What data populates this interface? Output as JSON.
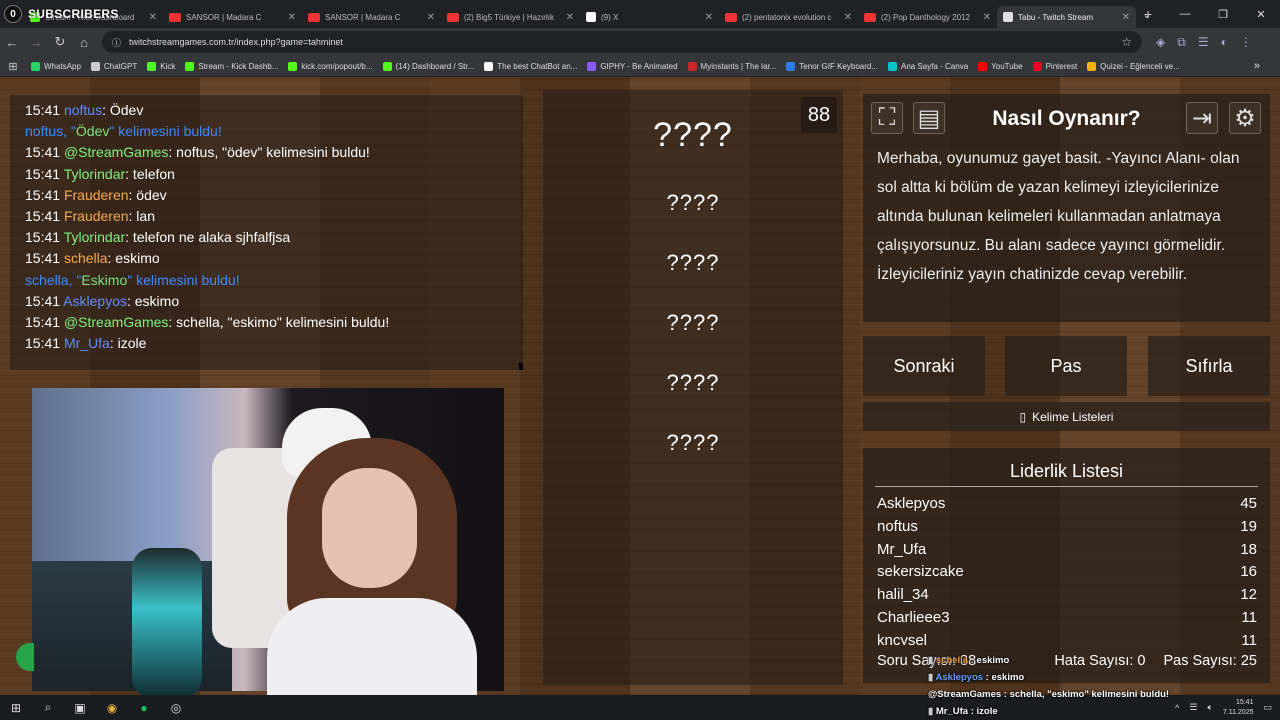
{
  "browser": {
    "overlay_badge": {
      "left_count": "0",
      "label": "SUBSCRIBERS",
      "right_count": "5"
    },
    "tabs": [
      {
        "title": "Stream - Kick Dashboard",
        "icon": "kick"
      },
      {
        "title": "SANSOR | Madara C",
        "icon": "youtube"
      },
      {
        "title": "SANSOR | Madara C",
        "icon": "youtube"
      },
      {
        "title": "(2) Big5 Türkiye | Hazırlık",
        "icon": "youtube"
      },
      {
        "title": "(9) X",
        "icon": "x"
      },
      {
        "title": "(2) pentatonix evolution c",
        "icon": "youtube"
      },
      {
        "title": "(2) Pop Danthology 2012",
        "icon": "youtube"
      },
      {
        "title": "Tabu - Twitch Stream",
        "icon": "twitch",
        "active": true
      }
    ],
    "url": "twitchstreamgames.com.tr/index.php?game=tahminet",
    "bookmarks": [
      {
        "label": "WhatsApp",
        "color": "#25d366"
      },
      {
        "label": "ChatGPT",
        "color": "#cccccc"
      },
      {
        "label": "Kick",
        "color": "#53fc18"
      },
      {
        "label": "Stream - Kick Dashb...",
        "color": "#53fc18"
      },
      {
        "label": "kick.com/popout/b...",
        "color": "#53fc18"
      },
      {
        "label": "(14) Dashboard / Str...",
        "color": "#53fc18"
      },
      {
        "label": "The best ChatBot an...",
        "color": "#ffffff"
      },
      {
        "label": "GIPHY - Be Animated",
        "color": "#8a5cf6"
      },
      {
        "label": "Myinstants | The lar...",
        "color": "#c62828"
      },
      {
        "label": "Tenor GIF Keyboard...",
        "color": "#2b7de9"
      },
      {
        "label": "Ana Sayfa - Canva",
        "color": "#00c4cc"
      },
      {
        "label": "YouTube",
        "color": "#ff0000"
      },
      {
        "label": "Pinterest",
        "color": "#e60023"
      },
      {
        "label": "Quizei - Eğlenceli ve...",
        "color": "#f4b400"
      }
    ]
  },
  "chat": [
    {
      "time": "15:41",
      "user": "noftus",
      "user_color": "blue",
      "msg": ": Ödev",
      "type": "user"
    },
    {
      "type": "system",
      "pre": "noftus, \"",
      "word": "Ödev",
      "post": "\" kelimesini buldu!"
    },
    {
      "time": "15:41",
      "user": "@StreamGames",
      "user_color": "green",
      "msg": ": noftus, \"ödev\" kelimesini buldu!",
      "type": "user"
    },
    {
      "time": "15:41",
      "user": "Tylorindar",
      "user_color": "green",
      "msg": ": telefon",
      "type": "user"
    },
    {
      "time": "15:41",
      "user": "Frauderen",
      "user_color": "orange",
      "msg": ": ödev",
      "type": "user"
    },
    {
      "time": "15:41",
      "user": "Frauderen",
      "user_color": "orange",
      "msg": ": lan",
      "type": "user"
    },
    {
      "time": "15:41",
      "user": "Tylorindar",
      "user_color": "green",
      "msg": ": telefon ne alaka sjhfalfjsa",
      "type": "user"
    },
    {
      "time": "15:41",
      "user": "schella",
      "user_color": "orange",
      "msg": ": eskimo",
      "type": "user"
    },
    {
      "type": "system",
      "pre": "schella, \"",
      "word": "Eskimo",
      "post": "\" kelimesini buldu!"
    },
    {
      "time": "15:41",
      "user": "Asklepyos",
      "user_color": "blue",
      "msg": ": eskimo",
      "type": "user"
    },
    {
      "time": "15:41",
      "user": "@StreamGames",
      "user_color": "green",
      "msg": ": schella, \"eskimo\" kelimesini buldu!",
      "type": "user"
    },
    {
      "time": "15:41",
      "user": "Mr_Ufa",
      "user_color": "blue",
      "msg": ": izole",
      "type": "user"
    }
  ],
  "game": {
    "timer": "88",
    "main_word": "????",
    "forbidden_words": [
      "????",
      "????",
      "????",
      "????",
      "????"
    ]
  },
  "info": {
    "title": "Nasıl Oynanır?",
    "text": "Merhaba, oyunumuz gayet basit. -Yayıncı Alanı- olan sol altta ki bölüm de yazan kelimeyi izleyicilerinize altında bulunan kelimeleri kullanmadan anlatmaya çalışıyorsunuz. Bu alanı sadece yayıncı görmelidir. İzleyicileriniz yayın chatinizde cevap verebilir."
  },
  "controls": {
    "next": "Sonraki",
    "pass": "Pas",
    "reset": "Sıfırla",
    "word_lists": "Kelime Listeleri"
  },
  "leaderboard": {
    "title": "Liderlik Listesi",
    "rows": [
      {
        "name": "Asklepyos",
        "score": "45"
      },
      {
        "name": "noftus",
        "score": "19"
      },
      {
        "name": "Mr_Ufa",
        "score": "18"
      },
      {
        "name": "sekersizcake",
        "score": "16"
      },
      {
        "name": "halil_34",
        "score": "12"
      },
      {
        "name": "Charlieee3",
        "score": "11"
      },
      {
        "name": "knсуsel",
        "score": "11"
      }
    ],
    "question_count": "Soru Sayısı: 38",
    "error_count": "Hata Sayısı: 0",
    "pass_count": "Pas Sayısı: 25"
  },
  "overlay_chat": [
    {
      "user": "schella",
      "msg": " : eskimo",
      "color": "orange"
    },
    {
      "user": "Asklepyos",
      "msg": " : eskimo",
      "color": "blue"
    },
    {
      "user": "@StreamGames",
      "msg": " : schella, \"eskimo\" kelimesini buldu!",
      "color": "green"
    },
    {
      "user": "Mr_Ufa",
      "msg": " : izole",
      "color": "white"
    }
  ],
  "taskbar": {
    "time": "15:41",
    "date": "7.11.2025"
  }
}
